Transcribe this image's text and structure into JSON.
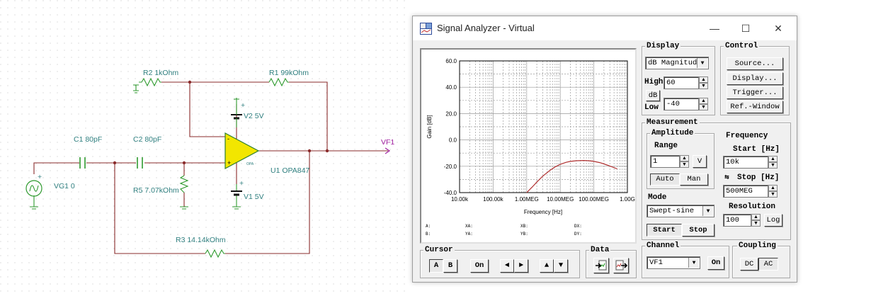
{
  "schematic": {
    "r2_label": "R2 1kOhm",
    "r1_label": "R1 99kOhm",
    "v2_label": "V2 5V",
    "v1_label": "V1 5V",
    "c1_label": "C1 80pF",
    "c2_label": "C2 80pF",
    "vg_label": "VG1 0",
    "r5_label": "R5 7.07kOhm",
    "u1_label": "U1 OPA847",
    "r3_label": "R3 14.14kOhm",
    "vf_label": "VF1",
    "plus": "+",
    "minus": "-",
    "opamp_tag": "OPA"
  },
  "window": {
    "title": "Signal Analyzer - Virtual",
    "minimize": "—",
    "maximize": "☐",
    "close": "✕"
  },
  "display": {
    "title": "Display",
    "mode_value": "dB Magnitud",
    "high_label": "High",
    "high_value": "60",
    "db_button": "dB",
    "low_label": "Low",
    "low_value": "-40"
  },
  "control": {
    "title": "Control",
    "source": "Source...",
    "display": "Display...",
    "trigger": "Trigger...",
    "ref_window": "Ref.-Window"
  },
  "measurement": {
    "title": "Measurement",
    "amplitude_title": "Amplitude",
    "range_label": "Range",
    "range_value": "1",
    "volt_button": "V",
    "auto_button": "Auto",
    "man_button": "Man",
    "mode_label": "Mode",
    "mode_value": "Swept-sine",
    "start_button": "Start",
    "stop_button": "Stop",
    "frequency_title": "Frequency",
    "start_label": "Start [Hz]",
    "start_value": "10k",
    "stop_label": "Stop [Hz]",
    "stop_value": "500MEG",
    "resolution_label": "Resolution",
    "resolution_value": "100",
    "log_button": "Log"
  },
  "cursor": {
    "title": "Cursor",
    "a": "A",
    "b": "B",
    "on": "On",
    "prev": "◄",
    "next": "►",
    "up": "▲",
    "down": "▼"
  },
  "data_group": {
    "title": "Data"
  },
  "channel": {
    "title": "Channel",
    "value": "VF1",
    "on": "On"
  },
  "coupling": {
    "title": "Coupling",
    "dc": "DC",
    "ac": "AC"
  },
  "readouts": {
    "a": "A:",
    "b": "B:",
    "xa": "XA:",
    "ya": "YA:",
    "xb": "XB:",
    "yb": "YB:",
    "dx": "DX:",
    "dy": "DY:"
  },
  "colors": {
    "trace": "#b03030",
    "component": "#2f7f7f",
    "wire": "#8a2b2b",
    "opamp": "#f2e600"
  },
  "chart_data": {
    "type": "line",
    "xscale": "log",
    "xlabel": "Frequency [Hz]",
    "ylabel": "Gain [dB]",
    "xlim": [
      10000,
      1000000000
    ],
    "ylim": [
      -40,
      60
    ],
    "grid": true,
    "xticks": [
      "10.00k",
      "100.00k",
      "1.00MEG",
      "10.00MEG",
      "100.00MEG",
      "1.00G"
    ],
    "yticks": [
      "-40.0",
      "-20.0",
      "0.0",
      "20.0",
      "40.0",
      "60.0"
    ],
    "series": [
      {
        "x": [
          1000000,
          1500000,
          2000000,
          3000000,
          5000000,
          7000000,
          10000000,
          15000000,
          20000000,
          30000000,
          50000000,
          70000000,
          100000000,
          150000000,
          200000000,
          300000000,
          500000000
        ],
        "y": [
          -40,
          -35.5,
          -32,
          -27.5,
          -23,
          -20.5,
          -18.5,
          -17,
          -16.3,
          -15.8,
          -15.6,
          -15.8,
          -16.3,
          -17.2,
          -18.2,
          -19.8,
          -22
        ]
      }
    ]
  }
}
